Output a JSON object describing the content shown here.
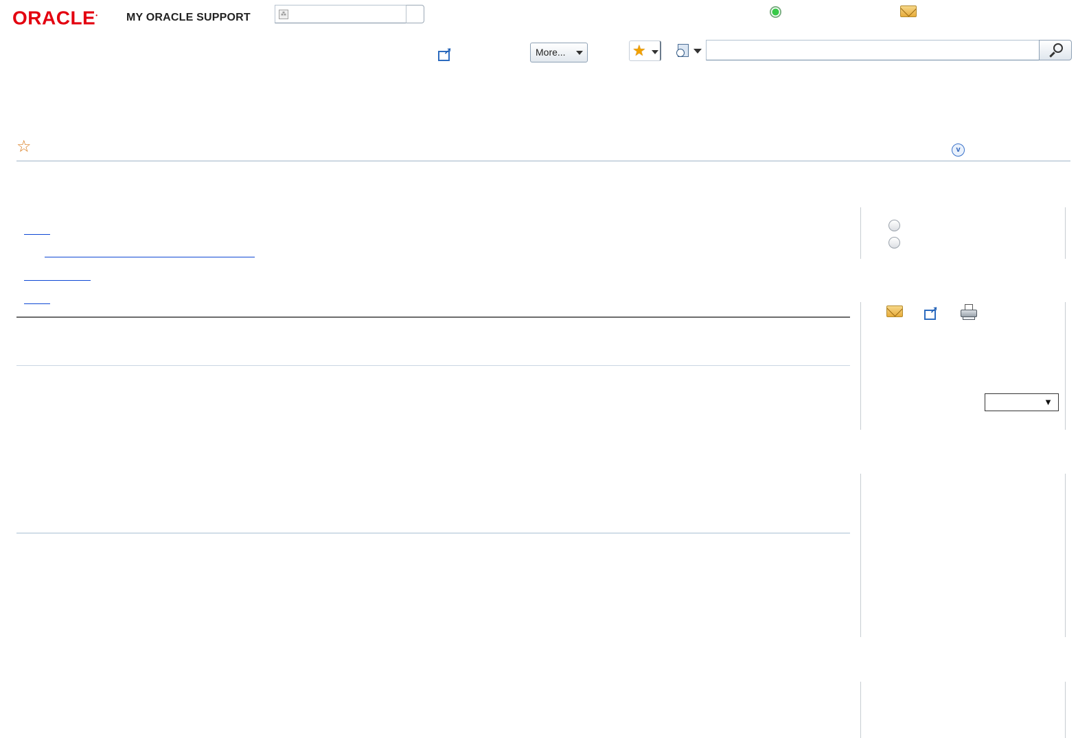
{
  "brand": {
    "logo_text": "ORACLE",
    "product_text": "MY ORACLE SUPPORT",
    "logo_color": "#e3000f"
  },
  "header": {
    "status_indicator": "green-circle-icon",
    "more_label": "More...",
    "search": {
      "value": "",
      "placeholder": ""
    }
  },
  "icons": {
    "mail": "envelope-icon",
    "open_window": "external-window-icon",
    "print": "printer-icon",
    "favorite": "star-icon",
    "recent": "recent-items-icon",
    "search": "magnifier-icon",
    "expand": "chevron-down-circle-icon"
  },
  "colors": {
    "accent": "#0d47d4",
    "rule_dark": "#6b6b6b",
    "rule_light": "#c9d6e3",
    "star": "#d97a1a"
  },
  "side_panel": {
    "sort_select": {
      "selected": ""
    }
  }
}
